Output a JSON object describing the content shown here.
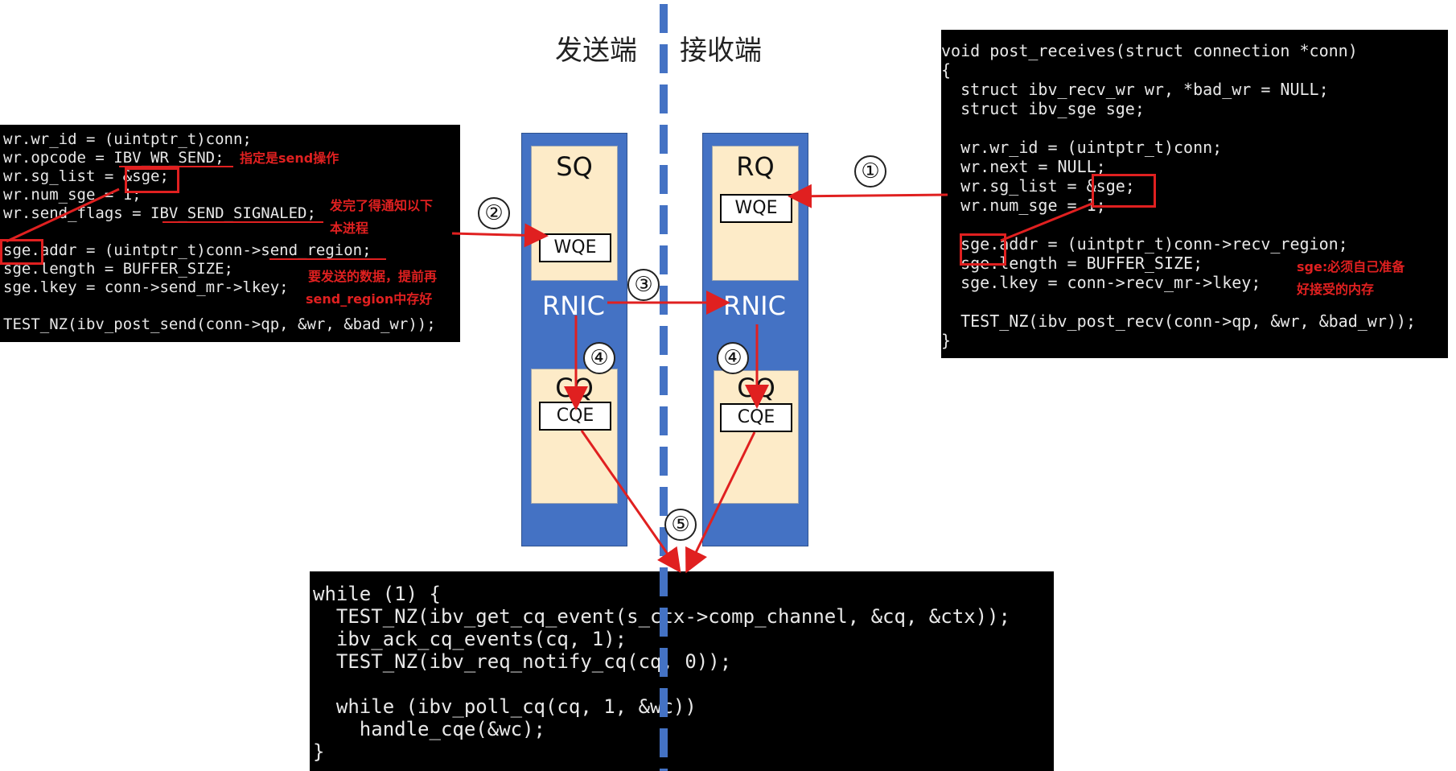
{
  "sides": {
    "sender": "发送端",
    "receiver": "接收端"
  },
  "queues": {
    "sq": "SQ",
    "rq": "RQ",
    "cq_left": "CQ",
    "cq_right": "CQ",
    "wqe_left": "WQE",
    "wqe_right": "WQE",
    "cqe_left": "CQE",
    "cqe_right": "CQE",
    "rnic_left": "RNIC",
    "rnic_right": "RNIC"
  },
  "steps": {
    "s1": "①",
    "s2": "②",
    "s3": "③",
    "s4a": "④",
    "s4b": "④",
    "s5": "⑤"
  },
  "left_code": {
    "lines": [
      "wr.wr_id = (uintptr_t)conn;",
      "wr.opcode = IBV_WR_SEND;",
      "wr.sg_list = &sge;",
      "wr.num_sge = 1;",
      "wr.send_flags = IBV_SEND_SIGNALED;",
      "",
      "sge.addr = (uintptr_t)conn->send_region;",
      "sge.length = BUFFER_SIZE;",
      "sge.lkey = conn->send_mr->lkey;",
      "",
      "TEST_NZ(ibv_post_send(conn->qp, &wr, &bad_wr));"
    ]
  },
  "right_code": {
    "lines": [
      "void post_receives(struct connection *conn)",
      "{",
      "  struct ibv_recv_wr wr, *bad_wr = NULL;",
      "  struct ibv_sge sge;",
      "",
      "  wr.wr_id = (uintptr_t)conn;",
      "  wr.next = NULL;",
      "  wr.sg_list = &sge;",
      "  wr.num_sge = 1;",
      "",
      "  sge.addr = (uintptr_t)conn->recv_region;",
      "  sge.length = BUFFER_SIZE;",
      "  sge.lkey = conn->recv_mr->lkey;",
      "",
      "  TEST_NZ(ibv_post_recv(conn->qp, &wr, &bad_wr));",
      "}"
    ]
  },
  "bottom_code": {
    "lines": [
      "while (1) {",
      "  TEST_NZ(ibv_get_cq_event(s_ctx->comp_channel, &cq, &ctx));",
      "  ibv_ack_cq_events(cq, 1);",
      "  TEST_NZ(ibv_req_notify_cq(cq, 0));",
      "",
      "  while (ibv_poll_cq(cq, 1, &wc))",
      "    handle_cqe(&wc);",
      "}"
    ]
  },
  "annotations": {
    "send_op": "指定是send操作",
    "notify_1": "发完了得通知以下",
    "notify_2": "本进程",
    "data_1": "要发送的数据，提前再",
    "data_2": "send_region中存好",
    "recv_1": "sge:必须自己准备",
    "recv_2": "好接受的内存"
  },
  "colors": {
    "column": "#4472c4",
    "queue_fill": "#fdebc8",
    "divider": "#4472c4",
    "arrow": "#e02020"
  }
}
